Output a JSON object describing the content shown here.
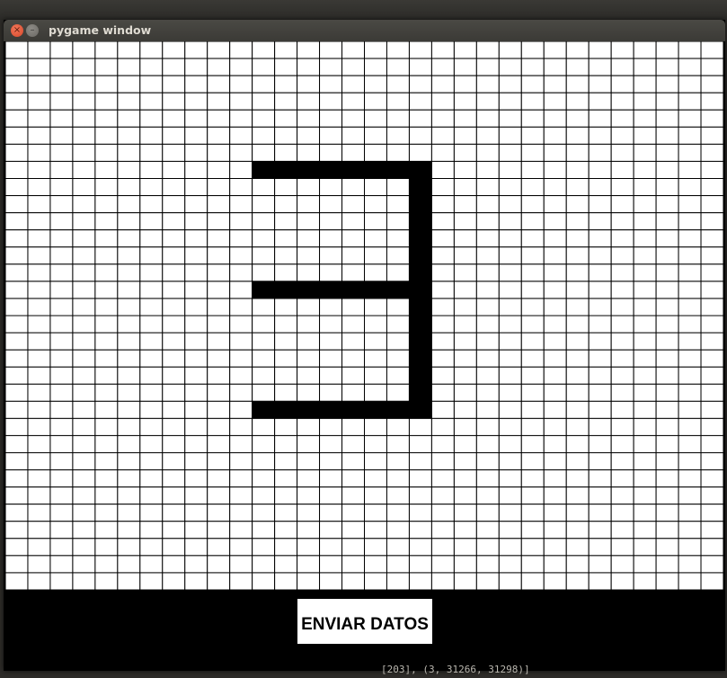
{
  "desktop": {
    "background_terminal_text": "[203], (3, 31266, 31298)]"
  },
  "window": {
    "title": "pygame window",
    "close_glyph": "×",
    "minimize_glyph": "–"
  },
  "grid": {
    "columns": 32,
    "rows": 32,
    "cell_fill": "#ffffff",
    "grid_line_color": "#000000",
    "painted_color": "#000000",
    "painted_cells": [
      [
        11,
        7
      ],
      [
        12,
        7
      ],
      [
        13,
        7
      ],
      [
        14,
        7
      ],
      [
        15,
        7
      ],
      [
        16,
        7
      ],
      [
        17,
        7
      ],
      [
        18,
        7
      ],
      [
        18,
        8
      ],
      [
        18,
        9
      ],
      [
        18,
        10
      ],
      [
        18,
        11
      ],
      [
        18,
        12
      ],
      [
        18,
        13
      ],
      [
        18,
        14
      ],
      [
        18,
        15
      ],
      [
        18,
        16
      ],
      [
        18,
        17
      ],
      [
        18,
        18
      ],
      [
        18,
        19
      ],
      [
        18,
        20
      ],
      [
        18,
        21
      ],
      [
        11,
        14
      ],
      [
        12,
        14
      ],
      [
        13,
        14
      ],
      [
        14,
        14
      ],
      [
        15,
        14
      ],
      [
        16,
        14
      ],
      [
        17,
        14
      ],
      [
        11,
        21
      ],
      [
        12,
        21
      ],
      [
        13,
        21
      ],
      [
        14,
        21
      ],
      [
        15,
        21
      ],
      [
        16,
        21
      ],
      [
        17,
        21
      ]
    ]
  },
  "controls": {
    "send_label": "ENVIAR DATOS"
  }
}
